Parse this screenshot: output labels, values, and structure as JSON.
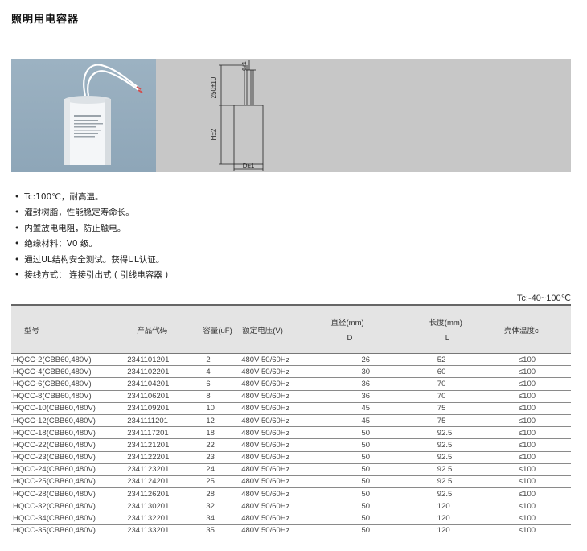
{
  "page": {
    "title": "照明用电容器"
  },
  "drawing": {
    "dim_top": "6±1",
    "dim_lead": "250±10",
    "dim_height": "H±2",
    "dim_diameter": "D±1"
  },
  "features": [
    "Tc:100℃，耐高温。",
    "灌封树脂，性能稳定寿命长。",
    "内置放电电阻，防止触电。",
    "绝缘材料：V0 级。",
    "通过UL结构安全测试。获得UL认证。",
    "接线方式：  连接引出式 ( 引线电容器 )"
  ],
  "temp_range": "Tc:-40~100℃",
  "table": {
    "headers": {
      "model": "型号",
      "code": "产品代码",
      "capacitance": "容量(uF)",
      "voltage": "额定电压(V)",
      "diameter": "直径(mm)",
      "diameter_sub": "D",
      "length": "长度(mm)",
      "length_sub": "L",
      "temp": "壳体温度c"
    },
    "rows": [
      [
        "HQCC-2(CBB60,480V)",
        "2341101201",
        "2",
        "480V 50/60Hz",
        "26",
        "52",
        "≤100"
      ],
      [
        "HQCC-4(CBB60,480V)",
        "2341102201",
        "4",
        "480V 50/60Hz",
        "30",
        "60",
        "≤100"
      ],
      [
        "HQCC-6(CBB60,480V)",
        "2341104201",
        "6",
        "480V 50/60Hz",
        "36",
        "70",
        "≤100"
      ],
      [
        "HQCC-8(CBB60,480V)",
        "2341106201",
        "8",
        "480V 50/60Hz",
        "36",
        "70",
        "≤100"
      ],
      [
        "HQCC-10(CBB60,480V)",
        "2341109201",
        "10",
        "480V 50/60Hz",
        "45",
        "75",
        "≤100"
      ],
      [
        "HQCC-12(CBB60,480V)",
        "2341111201",
        "12",
        "480V 50/60Hz",
        "45",
        "75",
        "≤100"
      ],
      [
        "HQCC-18(CBB60,480V)",
        "2341117201",
        "18",
        "480V 50/60Hz",
        "50",
        "92.5",
        "≤100"
      ],
      [
        "HQCC-22(CBB60,480V)",
        "2341121201",
        "22",
        "480V 50/60Hz",
        "50",
        "92.5",
        "≤100"
      ],
      [
        "HQCC-23(CBB60,480V)",
        "2341122201",
        "23",
        "480V 50/60Hz",
        "50",
        "92.5",
        "≤100"
      ],
      [
        "HQCC-24(CBB60,480V)",
        "2341123201",
        "24",
        "480V 50/60Hz",
        "50",
        "92.5",
        "≤100"
      ],
      [
        "HQCC-25(CBB60,480V)",
        "2341124201",
        "25",
        "480V 50/60Hz",
        "50",
        "92.5",
        "≤100"
      ],
      [
        "HQCC-28(CBB60,480V)",
        "2341126201",
        "28",
        "480V 50/60Hz",
        "50",
        "92.5",
        "≤100"
      ],
      [
        "HQCC-32(CBB60,480V)",
        "2341130201",
        "32",
        "480V 50/60Hz",
        "50",
        "120",
        "≤100"
      ],
      [
        "HQCC-34(CBB60,480V)",
        "2341132201",
        "34",
        "480V 50/60Hz",
        "50",
        "120",
        "≤100"
      ],
      [
        "HQCC-35(CBB60,480V)",
        "2341133201",
        "35",
        "480V 50/60Hz",
        "50",
        "120",
        "≤100"
      ]
    ]
  }
}
